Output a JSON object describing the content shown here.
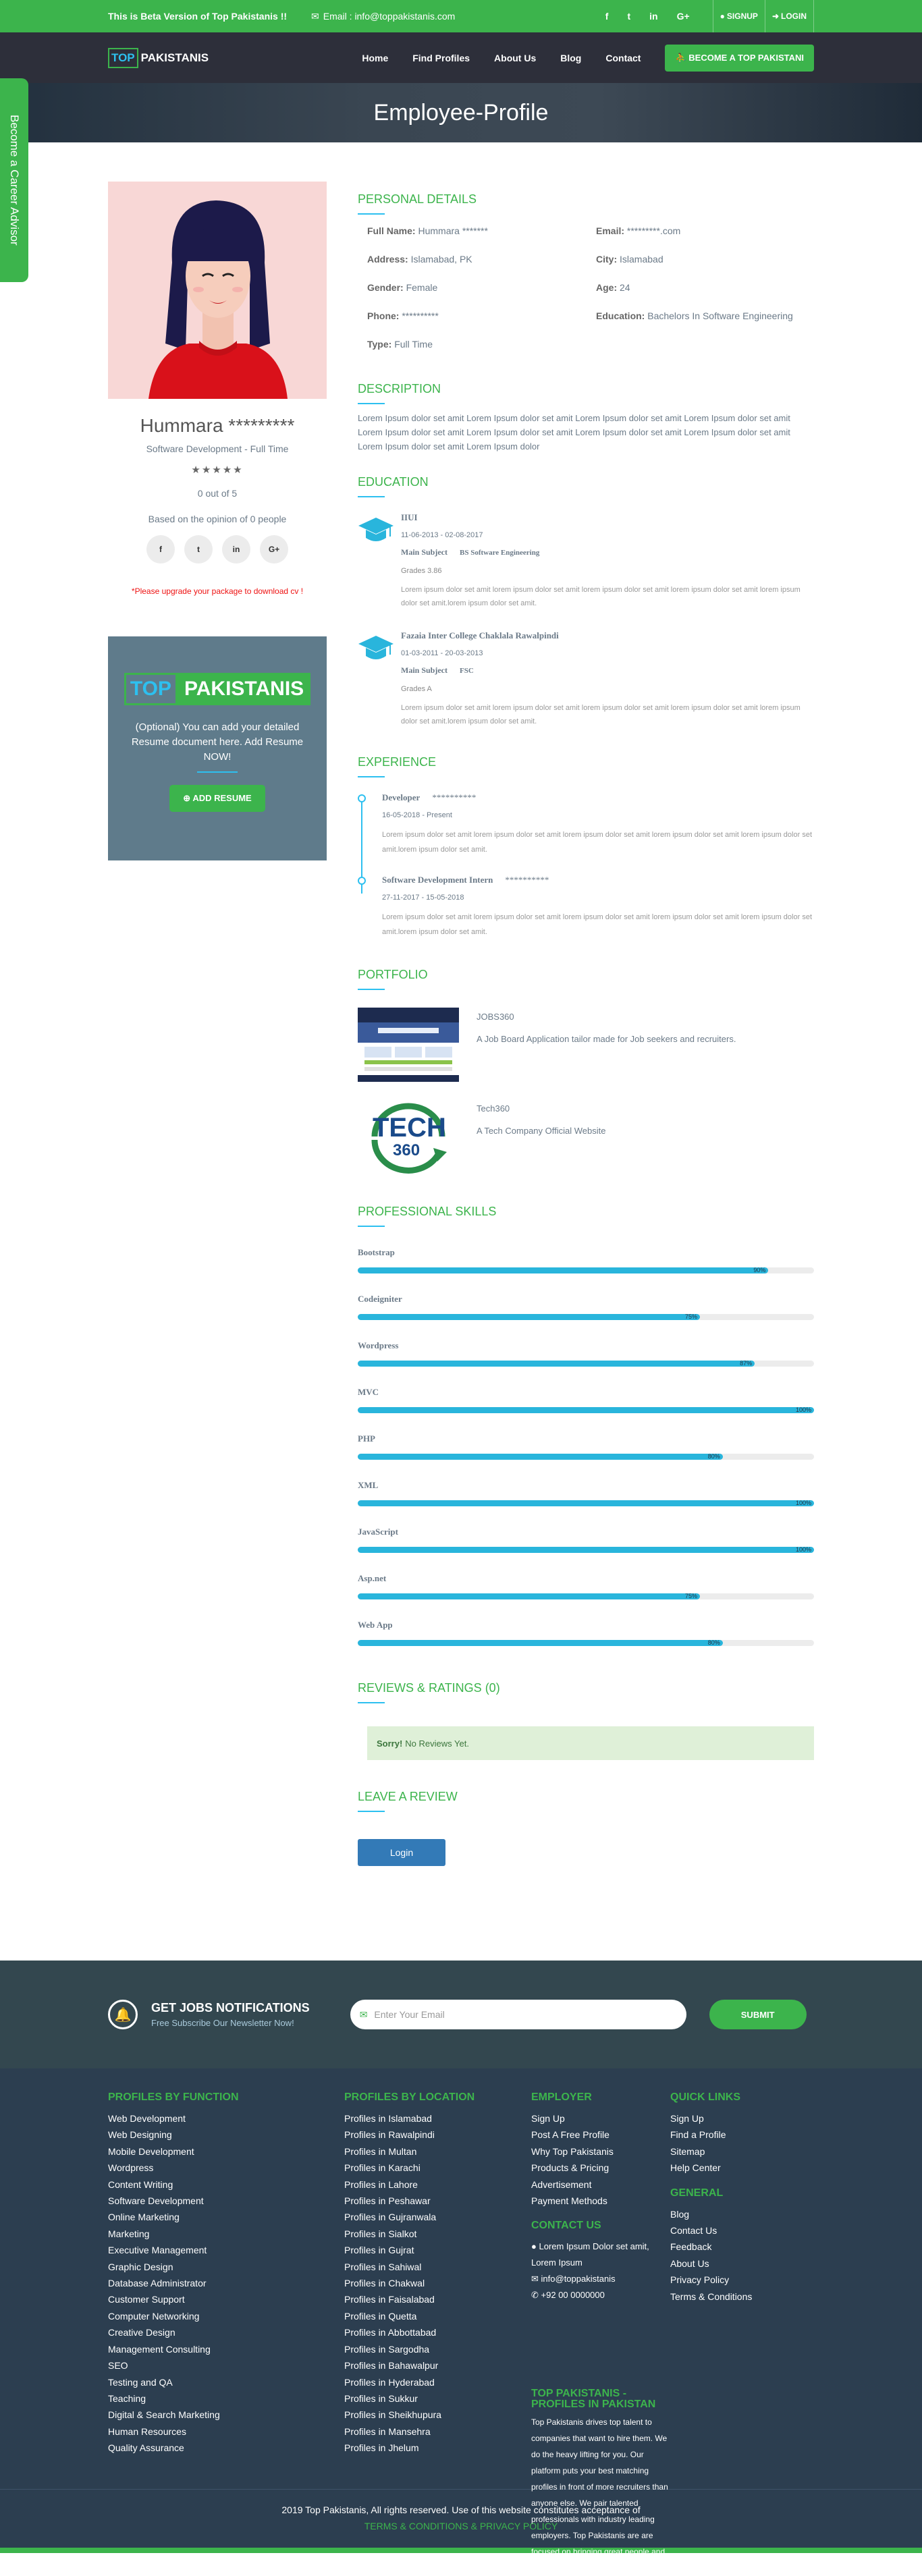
{
  "topbar": {
    "beta": "This is Beta Version of Top Pakistanis !!",
    "email": "Email : info@toppakistanis.com",
    "socials": [
      "f",
      "t",
      "in",
      "G+"
    ],
    "signup": "SIGNUP",
    "login": "LOGIN"
  },
  "navbar": {
    "logo_a": "TOP",
    "logo_b": "PAKISTANIS",
    "links": [
      "Home",
      "Find Profiles",
      "About Us",
      "Blog",
      "Contact"
    ],
    "cta": "BECOME A TOP PAKISTANI"
  },
  "banner": {
    "title": "Employee-Profile"
  },
  "sidetab": {
    "label": "Become a Career Advisor"
  },
  "profile": {
    "name": "Hummara *********",
    "role": "Software Development - Full Time",
    "stars": "★★★★★",
    "ratio": "0 out of 5",
    "opinion": "Based on the opinion of 0 people",
    "social": [
      "f",
      "t",
      "in",
      "G+"
    ],
    "upgrade": "*Please upgrade your package to download cv !"
  },
  "resume_box": {
    "logo_a": "TOP",
    "logo_b": "PAKISTANIS",
    "text": "(Optional) You can add your detailed Resume document here. Add Resume NOW!",
    "button": "ADD RESUME"
  },
  "personal": {
    "title": "PERSONAL DETAILS",
    "fields": [
      {
        "label": "Full Name:",
        "value": "Hummara *******"
      },
      {
        "label": "Email:",
        "value": "*********.com"
      },
      {
        "label": "Address:",
        "value": "Islamabad, PK"
      },
      {
        "label": "City:",
        "value": "Islamabad"
      },
      {
        "label": "Gender:",
        "value": "Female"
      },
      {
        "label": "Age:",
        "value": "24"
      },
      {
        "label": "Phone:",
        "value": "**********"
      },
      {
        "label": "Education:",
        "value": "Bachelors In Software Engineering"
      },
      {
        "label": "Type:",
        "value": "Full Time"
      }
    ]
  },
  "description": {
    "title": "DESCRIPTION",
    "text": "Lorem Ipsum dolor set amit Lorem Ipsum dolor set amit Lorem Ipsum dolor set amit Lorem Ipsum dolor set amit Lorem Ipsum dolor set amit Lorem Ipsum dolor set amit Lorem Ipsum dolor set amit Lorem Ipsum dolor set amit Lorem Ipsum dolor set amit Lorem Ipsum dolor"
  },
  "education": {
    "title": "EDUCATION",
    "items": [
      {
        "inst": "IIUI",
        "date": "11-06-2013 - 02-08-2017",
        "subject_label": "Main Subject",
        "subject": "BS Software Engineering",
        "grade": "Grades 3.86",
        "desc": "Lorem ipsum dolor set amit lorem ipsum dolor set amit lorem ipsum dolor set amit lorem ipsum dolor set amit lorem ipsum dolor set amit.lorem ipsum dolor set amit."
      },
      {
        "inst": "Fazaia Inter College Chaklala Rawalpindi",
        "date": "01-03-2011 - 20-03-2013",
        "subject_label": "Main Subject",
        "subject": "FSC",
        "grade": "Grades A",
        "desc": "Lorem ipsum dolor set amit lorem ipsum dolor set amit lorem ipsum dolor set amit lorem ipsum dolor set amit lorem ipsum dolor set amit.lorem ipsum dolor set amit."
      }
    ]
  },
  "experience": {
    "title": "EXPERIENCE",
    "items": [
      {
        "title": "Developer",
        "company": "**********",
        "date": "16-05-2018 - Present",
        "desc": "Lorem ipsum dolor set amit lorem ipsum dolor set amit lorem ipsum dolor set amit lorem ipsum dolor set amit lorem ipsum dolor set amit.lorem ipsum dolor set amit."
      },
      {
        "title": "Software Development Intern",
        "company": "**********",
        "date": "27-11-2017 - 15-05-2018",
        "desc": "Lorem ipsum dolor set amit lorem ipsum dolor set amit lorem ipsum dolor set amit lorem ipsum dolor set amit lorem ipsum dolor set amit.lorem ipsum dolor set amit."
      }
    ]
  },
  "portfolio": {
    "title": "PORTFOLIO",
    "items": [
      {
        "name": "JOBS360",
        "desc": "A Job Board Application tailor made for Job seekers and recruiters."
      },
      {
        "name": "Tech360",
        "desc": "A Tech Company Official Website",
        "logo_a": "TECH",
        "logo_b": "360"
      }
    ]
  },
  "skills": {
    "title": "PROFESSIONAL SKILLS",
    "items": [
      {
        "name": "Bootstrap",
        "pct": 90,
        "label": "90%"
      },
      {
        "name": "Codeigniter",
        "pct": 75,
        "label": "75%"
      },
      {
        "name": "Wordpress",
        "pct": 87,
        "label": "87%"
      },
      {
        "name": "MVC",
        "pct": 100,
        "label": "100%"
      },
      {
        "name": "PHP",
        "pct": 80,
        "label": "80%"
      },
      {
        "name": "XML",
        "pct": 100,
        "label": "100%"
      },
      {
        "name": "JavaScript",
        "pct": 100,
        "label": "100%"
      },
      {
        "name": "Asp.net",
        "pct": 75,
        "label": "75%"
      },
      {
        "name": "Web App",
        "pct": 80,
        "label": "80%"
      }
    ]
  },
  "reviews": {
    "title": "REVIEWS & RATINGS (0)",
    "sorry": "Sorry!",
    "message": "No Reviews Yet."
  },
  "leave_review": {
    "title": "LEAVE A REVIEW",
    "button": "Login"
  },
  "newsletter": {
    "title": "GET JOBS NOTIFICATIONS",
    "sub": "Free Subscribe Our Newsletter Now!",
    "placeholder": "Enter Your Email",
    "button": "SUBMIT"
  },
  "footer": {
    "function_title": "PROFILES BY FUNCTION",
    "function_links": [
      "Web Development",
      "Web Designing",
      "Mobile Development",
      "Wordpress",
      "Content Writing",
      "Software Development",
      "Online Marketing",
      "Marketing",
      "Executive Management",
      "Graphic Design",
      "Database Administrator",
      "Customer Support",
      "Computer Networking",
      "Creative Design",
      "Management Consulting",
      "SEO",
      "Testing and QA",
      "Teaching",
      "Digital & Search Marketing",
      "Human Resources",
      "Quality Assurance"
    ],
    "location_title": "PROFILES BY LOCATION",
    "location_links": [
      "Profiles in Islamabad",
      "Profiles in Rawalpindi",
      "Profiles in Multan",
      "Profiles in Karachi",
      "Profiles in Lahore",
      "Profiles in Peshawar",
      "Profiles in Gujranwala",
      "Profiles in Sialkot",
      "Profiles in Gujrat",
      "Profiles in Sahiwal",
      "Profiles in Chakwal",
      "Profiles in Faisalabad",
      "Profiles in Quetta",
      "Profiles in Abbottabad",
      "Profiles in Sargodha",
      "Profiles in Bahawalpur",
      "Profiles in Hyderabad",
      "Profiles in Sukkur",
      "Profiles in Sheikhupura",
      "Profiles in Mansehra",
      "Profiles in Jhelum"
    ],
    "employer_title": "EMPLOYER",
    "employer_links": [
      "Sign Up",
      "Post A Free Profile",
      "Why Top Pakistanis",
      "Products & Pricing",
      "Advertisement",
      "Payment Methods"
    ],
    "contact_title": "CONTACT US",
    "contact_address": "Lorem Ipsum Dolor set amit, Lorem Ipsum",
    "contact_email": "info@toppakistanis",
    "contact_phone": "+92 00 0000000",
    "about_title": "TOP PAKISTANIS - PROFILES IN PAKISTAN",
    "about_text": "Top Pakistanis drives top talent to companies that want to hire them. We do the heavy lifting for you. Our platform puts your best matching profiles in front of more recruiters than anyone else. We pair talented professionals with industry leading employers. Top Pakistanis are are focused on bringing great people and great organizations together.t",
    "quick_title": "QUICK LINKS",
    "quick_links": [
      "Sign Up",
      "Find a Profile",
      "Sitemap",
      "Help Center"
    ],
    "general_title": "GENERAL",
    "general_links": [
      "Blog",
      "Contact Us",
      "Feedback",
      "About Us",
      "Privacy Policy",
      "Terms & Conditions"
    ],
    "copyright": "2019 Top Pakistanis, All rights reserved. Use of this website constitutes acceptance of",
    "terms": "TERMS & CONDITIONS & PRIVACY POLICY"
  }
}
